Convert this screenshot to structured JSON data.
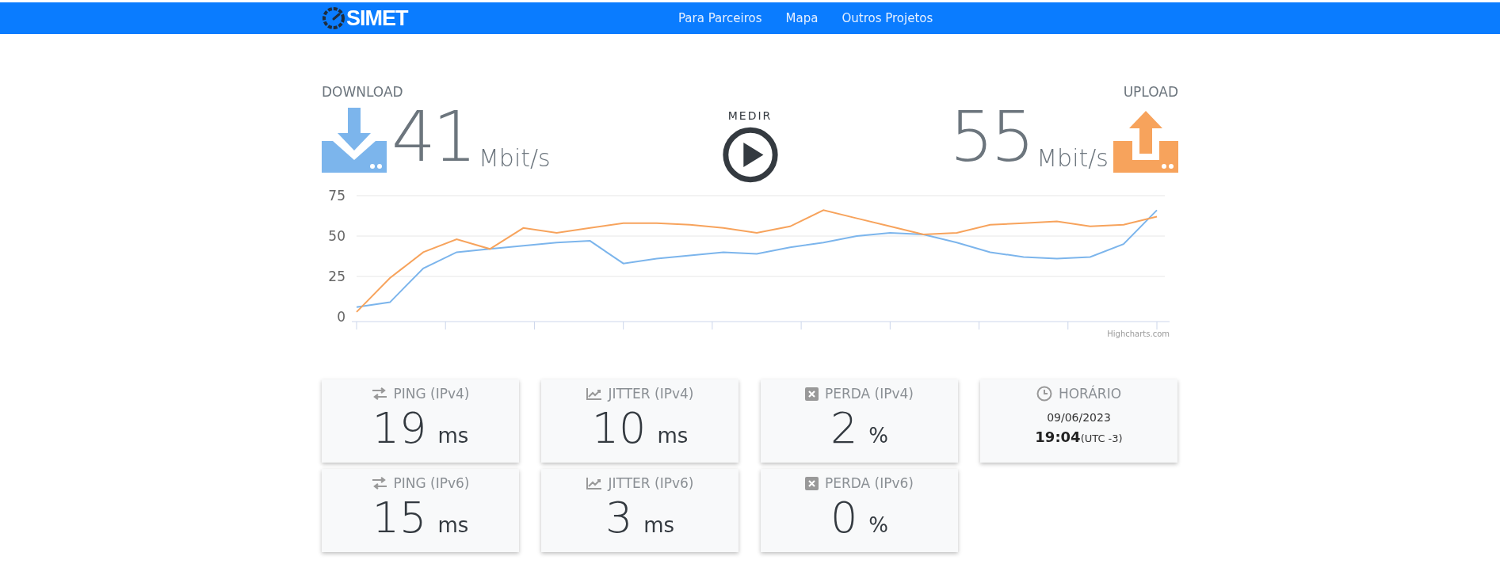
{
  "header": {
    "logo": "SIMET",
    "nav": [
      "Para Parceiros",
      "Mapa",
      "Outros Projetos"
    ]
  },
  "download": {
    "label": "DOWNLOAD",
    "value": "41",
    "unit": "Mbit/s"
  },
  "measure": {
    "label": "MEDIR"
  },
  "upload": {
    "label": "UPLOAD",
    "value": "55",
    "unit": "Mbit/s"
  },
  "chart": {
    "credit": "Highcharts.com",
    "chart_data": {
      "type": "line",
      "ylim": [
        0,
        75
      ],
      "yticks": [
        0,
        25,
        50,
        75
      ],
      "series": [
        {
          "color": "#7cb5ec",
          "values": [
            6,
            9,
            30,
            40,
            42,
            44,
            46,
            47,
            33,
            36,
            38,
            40,
            39,
            43,
            46,
            50,
            52,
            51,
            46,
            40,
            37,
            36,
            37,
            45,
            66
          ]
        },
        {
          "color": "#f7a35c",
          "values": [
            3,
            24,
            40,
            48,
            42,
            55,
            52,
            55,
            58,
            58,
            57,
            55,
            52,
            56,
            66,
            61,
            56,
            51,
            52,
            57,
            58,
            59,
            56,
            57,
            62
          ]
        }
      ]
    }
  },
  "cards": [
    {
      "kind": "ping",
      "label": "PING (IPv4)",
      "value": "19",
      "unit": "ms"
    },
    {
      "kind": "jitter",
      "label": "JITTER (IPv4)",
      "value": "10",
      "unit": "ms"
    },
    {
      "kind": "loss",
      "label": "PERDA (IPv4)",
      "value": "2",
      "unit": "%"
    },
    {
      "kind": "time",
      "label": "HORÁRIO",
      "date": "09/06/2023",
      "time": "19:04",
      "zone": "(UTC -3)"
    },
    {
      "kind": "ping",
      "label": "PING (IPv6)",
      "value": "15",
      "unit": "ms"
    },
    {
      "kind": "jitter",
      "label": "JITTER (IPv6)",
      "value": "3",
      "unit": "ms"
    },
    {
      "kind": "loss",
      "label": "PERDA (IPv6)",
      "value": "0",
      "unit": "%"
    }
  ]
}
